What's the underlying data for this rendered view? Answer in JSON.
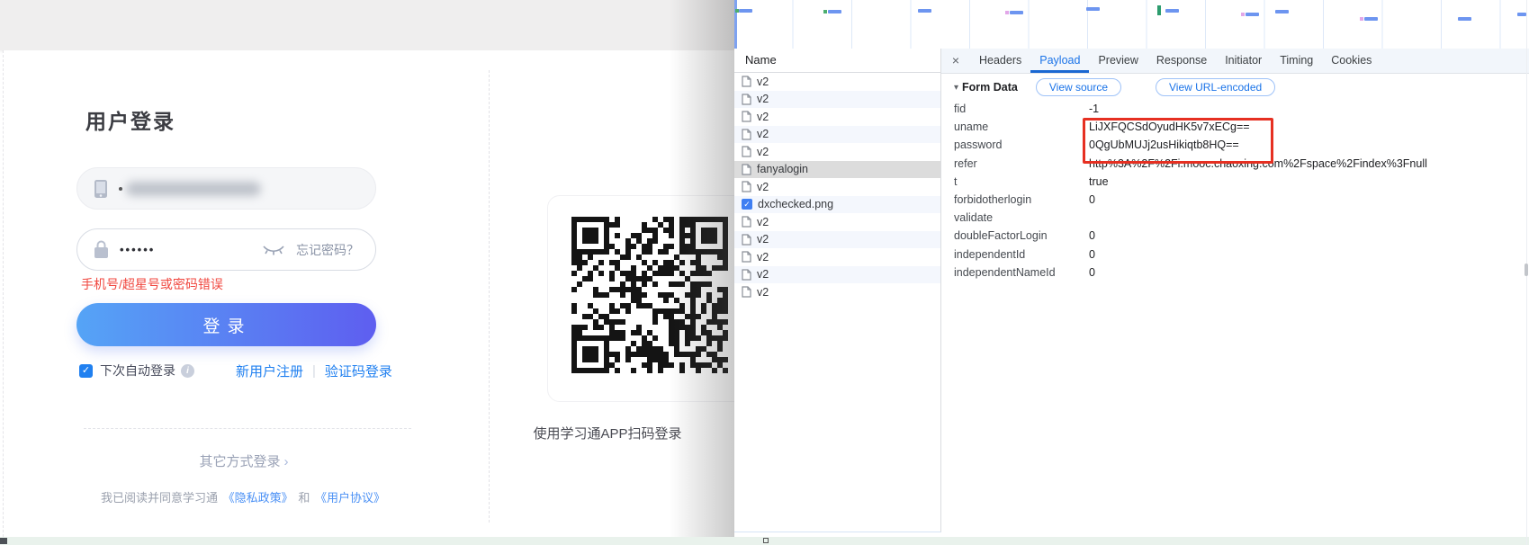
{
  "login": {
    "title": "用户登录",
    "password_mask": "••••••",
    "forgot_password": "忘记密码？",
    "error": "手机号/超星号或密码错误",
    "login_button": "登录",
    "auto_login": "下次自动登录",
    "register": "新用户注册",
    "link_divider": "|",
    "sms_login": "验证码登录",
    "other_login": "其它方式登录",
    "other_login_chevron": "›",
    "agreement_prefix": "我已阅读并同意学习通",
    "privacy_policy": "《隐私政策》",
    "and_word": "和",
    "user_agreement": "《用户协议》",
    "qr_caption": "使用学习通APP扫码登录",
    "colors": {
      "button_gradient_start": "#55a4f6",
      "button_gradient_end": "#5e5ef0",
      "error_red": "#f0473f",
      "link_blue": "#2080f0"
    }
  },
  "icons": {
    "caret": "▾",
    "check": "✓",
    "info": "i",
    "close": "×",
    "image_check": "✓"
  },
  "devtools": {
    "network": {
      "name_header": "Name",
      "requests": [
        {
          "name": "v2",
          "icon": "document-icon",
          "selected": false
        },
        {
          "name": "v2",
          "icon": "document-icon",
          "selected": false
        },
        {
          "name": "v2",
          "icon": "document-icon",
          "selected": false
        },
        {
          "name": "v2",
          "icon": "document-icon",
          "selected": false
        },
        {
          "name": "v2",
          "icon": "document-icon",
          "selected": false
        },
        {
          "name": "fanyalogin",
          "icon": "document-icon",
          "selected": true
        },
        {
          "name": "v2",
          "icon": "document-icon",
          "selected": false
        },
        {
          "name": "dxchecked.png",
          "icon": "image-icon",
          "selected": false
        },
        {
          "name": "v2",
          "icon": "document-icon",
          "selected": false
        },
        {
          "name": "v2",
          "icon": "document-icon",
          "selected": false
        },
        {
          "name": "v2",
          "icon": "document-icon",
          "selected": false
        },
        {
          "name": "v2",
          "icon": "document-icon",
          "selected": false
        },
        {
          "name": "v2",
          "icon": "document-icon",
          "selected": false
        }
      ]
    },
    "tabs": {
      "items": [
        "Headers",
        "Payload",
        "Preview",
        "Response",
        "Initiator",
        "Timing",
        "Cookies"
      ],
      "active": "Payload"
    },
    "payload": {
      "section_label": "Form Data",
      "view_source": "View source",
      "view_url_encoded": "View URL-encoded",
      "fields": [
        {
          "key": "fid",
          "value": "-1"
        },
        {
          "key": "uname",
          "value": "LiJXFQCSdOyudHK5v7xECg=="
        },
        {
          "key": "password",
          "value": "0QgUbMUJj2usHikiqtb8HQ=="
        },
        {
          "key": "refer",
          "value": "http%3A%2F%2Fi.mooc.chaoxing.com%2Fspace%2Findex%3Fnull"
        },
        {
          "key": "t",
          "value": "true"
        },
        {
          "key": "forbidotherlogin",
          "value": "0"
        },
        {
          "key": "validate",
          "value": ""
        },
        {
          "key": "doubleFactorLogin",
          "value": "0"
        },
        {
          "key": "independentId",
          "value": "0"
        },
        {
          "key": "independentNameId",
          "value": "0"
        }
      ],
      "highlight_box_color": "#e63022"
    },
    "colors": {
      "accent": "#1a73e8",
      "waterfall_bar": "#6d95f0"
    }
  }
}
